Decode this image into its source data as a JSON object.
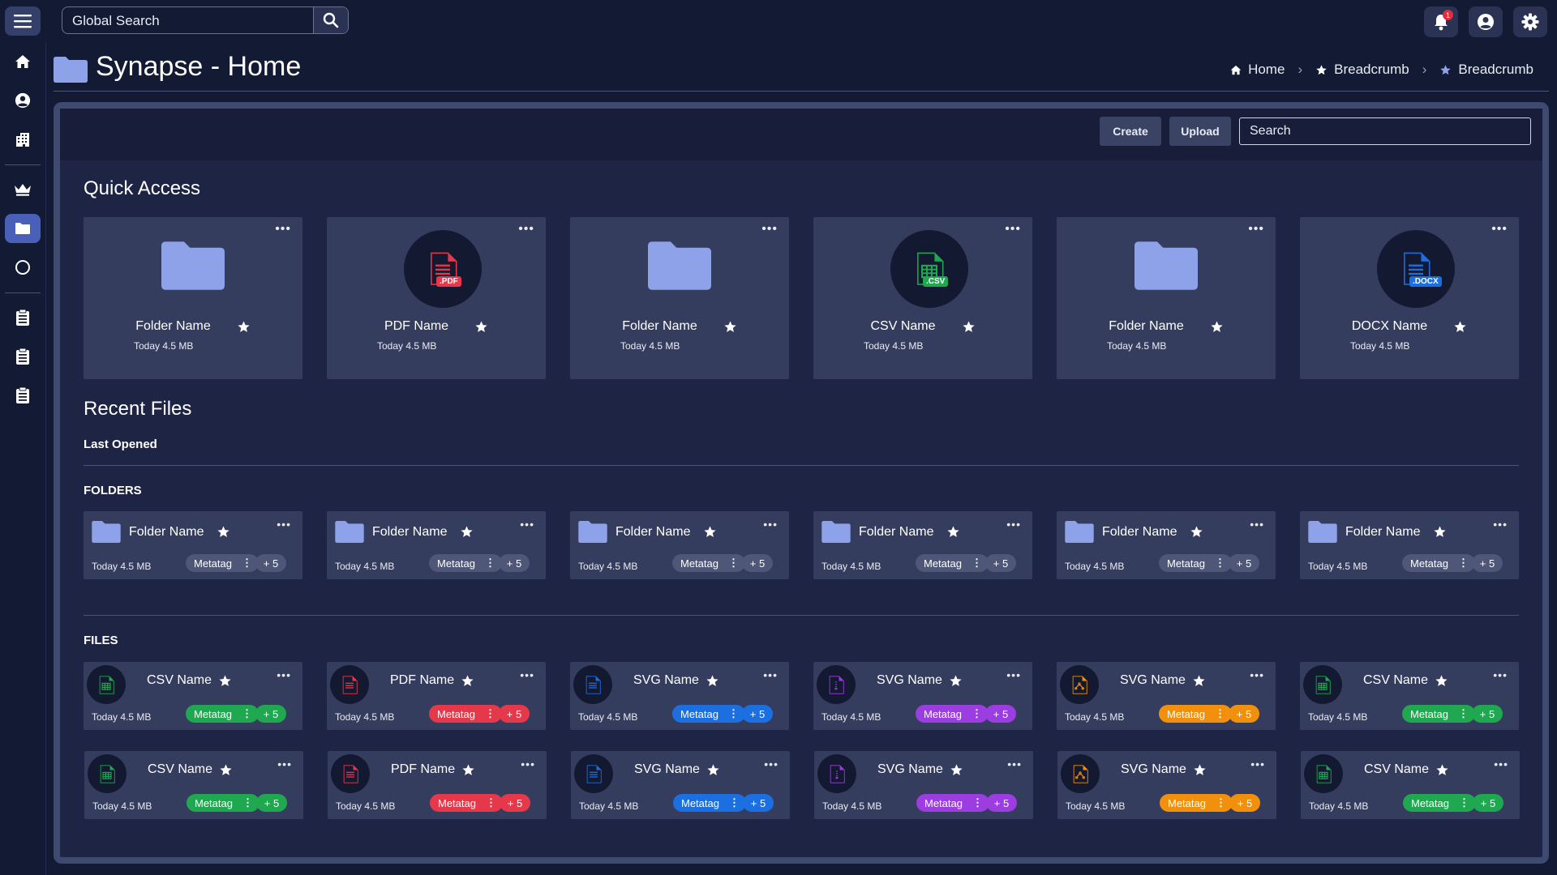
{
  "topbar": {
    "search_placeholder": "Global Search",
    "notification_count": "1"
  },
  "header": {
    "title": "Synapse - Home",
    "breadcrumb": [
      "Home",
      "Breadcrumb",
      "Breadcrumb"
    ]
  },
  "toolbar": {
    "create_label": "Create",
    "upload_label": "Upload",
    "search_placeholder": "Search"
  },
  "quick_access": {
    "title": "Quick Access",
    "items": [
      {
        "name": "Folder Name",
        "meta": "Today 4.5 MB",
        "kind": "folder"
      },
      {
        "name": "PDF Name",
        "meta": "Today 4.5 MB",
        "kind": "pdf",
        "badge": ".PDF"
      },
      {
        "name": "Folder Name",
        "meta": "Today 4.5 MB",
        "kind": "folder"
      },
      {
        "name": "CSV Name",
        "meta": "Today 4.5 MB",
        "kind": "csv",
        "badge": ".CSV"
      },
      {
        "name": "Folder Name",
        "meta": "Today 4.5 MB",
        "kind": "folder"
      },
      {
        "name": "DOCX Name",
        "meta": "Today 4.5 MB",
        "kind": "docx",
        "badge": ".DOCX"
      }
    ]
  },
  "recent": {
    "title": "Recent Files",
    "subtitle": "Last Opened",
    "folders_title": "FOLDERS",
    "files_title": "FILES",
    "folders": [
      {
        "name": "Folder Name",
        "meta": "Today 4.5 MB",
        "tag": "Metatag",
        "more": "+ 5"
      },
      {
        "name": "Folder Name",
        "meta": "Today 4.5 MB",
        "tag": "Metatag",
        "more": "+ 5"
      },
      {
        "name": "Folder Name",
        "meta": "Today 4.5 MB",
        "tag": "Metatag",
        "more": "+ 5"
      },
      {
        "name": "Folder Name",
        "meta": "Today 4.5 MB",
        "tag": "Metatag",
        "more": "+ 5"
      },
      {
        "name": "Folder Name",
        "meta": "Today 4.5 MB",
        "tag": "Metatag",
        "more": "+ 5"
      },
      {
        "name": "Folder Name",
        "meta": "Today 4.5 MB",
        "tag": "Metatag",
        "more": "+ 5"
      }
    ],
    "files": [
      {
        "name": "CSV Name",
        "meta": "Today 4.5 MB",
        "tag": "Metatag",
        "more": "+ 5",
        "kind": "csv",
        "color": "#1fa84f"
      },
      {
        "name": "PDF Name",
        "meta": "Today 4.5 MB",
        "tag": "Metatag",
        "more": "+ 5",
        "kind": "pdf",
        "color": "#e5384a"
      },
      {
        "name": "SVG Name",
        "meta": "Today 4.5 MB",
        "tag": "Metatag",
        "more": "+ 5",
        "kind": "docx",
        "color": "#1c6fe0"
      },
      {
        "name": "SVG Name",
        "meta": "Today 4.5 MB",
        "tag": "Metatag",
        "more": "+ 5",
        "kind": "zip",
        "color": "#9b3de0"
      },
      {
        "name": "SVG Name",
        "meta": "Today 4.5 MB",
        "tag": "Metatag",
        "more": "+ 5",
        "kind": "svg",
        "color": "#f0900c"
      },
      {
        "name": "CSV Name",
        "meta": "Today 4.5 MB",
        "tag": "Metatag",
        "more": "+ 5",
        "kind": "csv",
        "color": "#1fa84f"
      },
      {
        "name": "CSV Name",
        "meta": "Today 4.5 MB",
        "tag": "Metatag",
        "more": "+ 5",
        "kind": "csv",
        "color": "#1fa84f"
      },
      {
        "name": "PDF Name",
        "meta": "Today 4.5 MB",
        "tag": "Metatag",
        "more": "+ 5",
        "kind": "pdf",
        "color": "#e5384a"
      },
      {
        "name": "SVG Name",
        "meta": "Today 4.5 MB",
        "tag": "Metatag",
        "more": "+ 5",
        "kind": "docx",
        "color": "#1c6fe0"
      },
      {
        "name": "SVG Name",
        "meta": "Today 4.5 MB",
        "tag": "Metatag",
        "more": "+ 5",
        "kind": "zip",
        "color": "#9b3de0"
      },
      {
        "name": "SVG Name",
        "meta": "Today 4.5 MB",
        "tag": "Metatag",
        "more": "+ 5",
        "kind": "svg",
        "color": "#f0900c"
      },
      {
        "name": "CSV Name",
        "meta": "Today 4.5 MB",
        "tag": "Metatag",
        "more": "+ 5",
        "kind": "csv",
        "color": "#1fa84f"
      }
    ]
  },
  "colors": {
    "folder": "#8ea2ea",
    "pdf": "#e5384a",
    "csv": "#1fa84f",
    "docx": "#1c6fe0",
    "zip": "#9b3de0",
    "svg": "#f0900c",
    "active_nav": "#4a5fb8"
  }
}
